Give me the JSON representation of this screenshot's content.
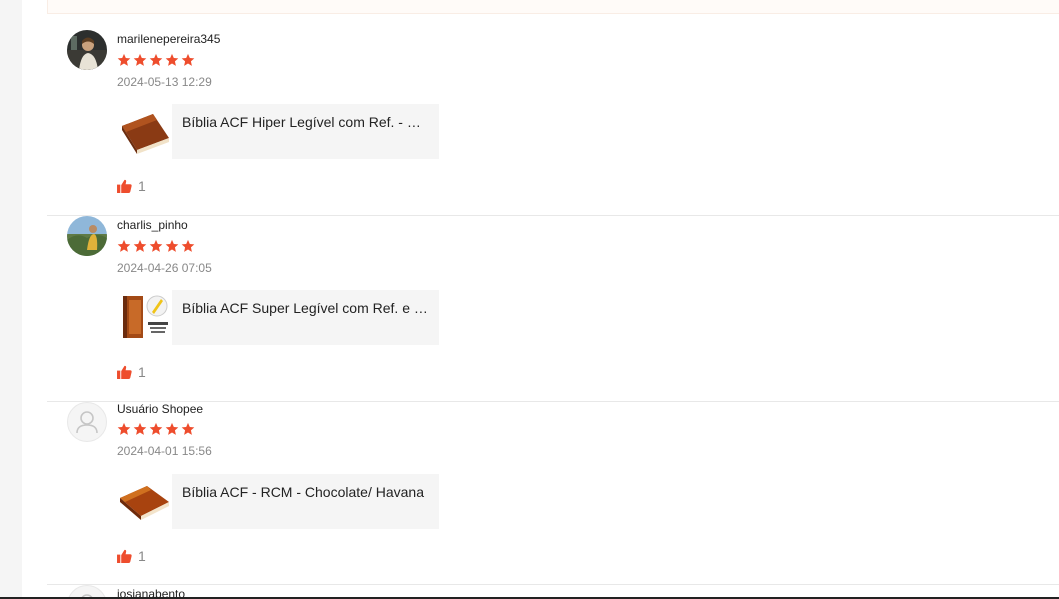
{
  "colors": {
    "star": "#ee4d2d",
    "like": "#ee4d2d",
    "muted": "#888888"
  },
  "reviews": [
    {
      "username": "marilenepereira345",
      "rating": 5,
      "date": "2024-05-13 12:29",
      "product": "Bíblia ACF Hiper Legível com Ref. - Marrom",
      "likes": "1"
    },
    {
      "username": "charlis_pinho",
      "rating": 5,
      "date": "2024-04-26 07:05",
      "product": "Bíblia ACF Super Legível com Ref. e Marcadores",
      "likes": "1"
    },
    {
      "username": "Usuário Shopee",
      "rating": 5,
      "date": "2024-04-01 15:56",
      "product": "Bíblia ACF - RCM - Chocolate/ Havana",
      "likes": "1"
    },
    {
      "username": "josianabento"
    }
  ]
}
